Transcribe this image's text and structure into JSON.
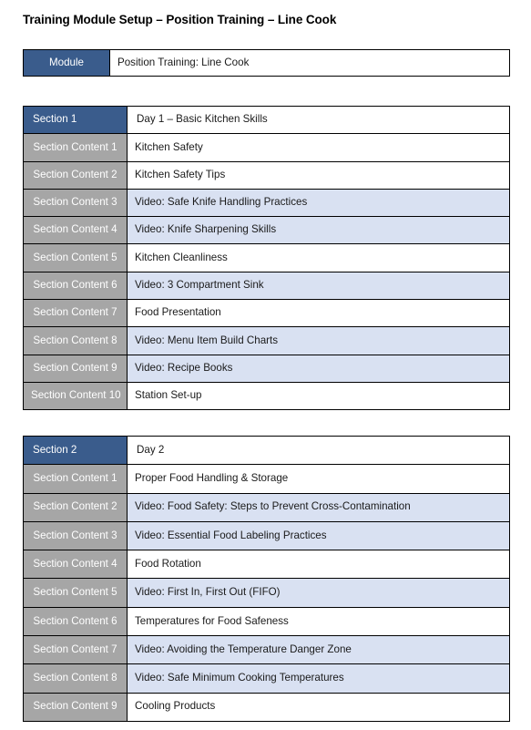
{
  "document": {
    "title": "Training Module Setup – Position Training – Line Cook"
  },
  "module": {
    "label": "Module",
    "value": "Position Training: Line Cook"
  },
  "sections": [
    {
      "label": "Section 1",
      "title": "Day 1 – Basic Kitchen Skills",
      "rows": [
        {
          "label": "Section Content 1",
          "value": "Kitchen Safety",
          "highlighted": false
        },
        {
          "label": "Section Content 2",
          "value": "Kitchen Safety Tips",
          "highlighted": false
        },
        {
          "label": "Section Content 3",
          "value": "Video: Safe Knife Handling Practices",
          "highlighted": true
        },
        {
          "label": "Section Content 4",
          "value": "Video: Knife Sharpening Skills",
          "highlighted": true
        },
        {
          "label": "Section Content 5",
          "value": "Kitchen Cleanliness",
          "highlighted": false
        },
        {
          "label": "Section Content 6",
          "value": "Video: 3 Compartment Sink",
          "highlighted": true
        },
        {
          "label": "Section Content 7",
          "value": "Food Presentation",
          "highlighted": false
        },
        {
          "label": "Section Content 8",
          "value": "Video: Menu Item Build Charts",
          "highlighted": true
        },
        {
          "label": "Section Content 9",
          "value": "Video: Recipe Books",
          "highlighted": true
        },
        {
          "label": "Section Content 10",
          "value": "Station Set-up",
          "highlighted": false
        }
      ]
    },
    {
      "label": "Section 2",
      "title": "Day 2",
      "rows": [
        {
          "label": "Section Content 1",
          "value": "Proper Food Handling & Storage",
          "highlighted": false
        },
        {
          "label": "Section Content 2",
          "value": "Video: Food Safety: Steps to Prevent Cross-Contamination",
          "highlighted": true
        },
        {
          "label": "Section Content 3",
          "value": "Video: Essential Food Labeling Practices",
          "highlighted": true
        },
        {
          "label": "Section Content 4",
          "value": "Food Rotation",
          "highlighted": false
        },
        {
          "label": "Section Content 5",
          "value": "Video: First In, First Out (FIFO)",
          "highlighted": true
        },
        {
          "label": "Section Content 6",
          "value": "Temperatures for Food Safeness",
          "highlighted": false
        },
        {
          "label": "Section Content 7",
          "value": "Video: Avoiding the Temperature Danger Zone",
          "highlighted": true
        },
        {
          "label": "Section Content 8",
          "value": "Video: Safe Minimum Cooking Temperatures",
          "highlighted": true
        },
        {
          "label": "Section Content 9",
          "value": "Cooling Products",
          "highlighted": false
        }
      ]
    }
  ],
  "colors": {
    "header_blue": "#3A5C8C",
    "label_gray": "#A6A6A6",
    "row_highlight": "#D9E1F2",
    "text": "#1A1A1A"
  }
}
